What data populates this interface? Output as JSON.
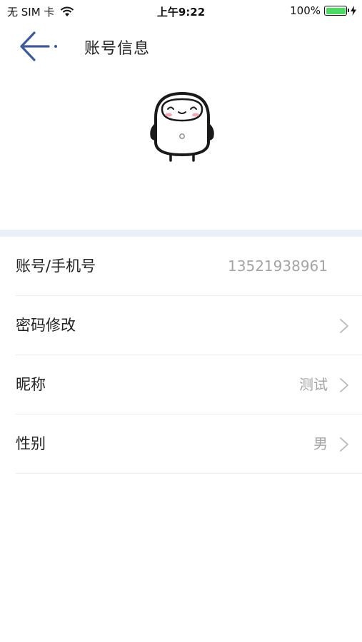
{
  "status_bar": {
    "carrier": "无 SIM 卡",
    "time": "上午9:22",
    "battery_percent": "100%",
    "battery_level": 1.0,
    "battery_color": "#4cd964"
  },
  "nav": {
    "back_icon": "back-arrow-icon",
    "title": "账号信息"
  },
  "avatar": {
    "icon": "robot-mascot-avatar"
  },
  "rows": [
    {
      "label": "账号/手机号",
      "value": "13521938961",
      "chevron": false
    },
    {
      "label": "密码修改",
      "value": "",
      "chevron": true
    },
    {
      "label": "昵称",
      "value": "测试",
      "chevron": true
    },
    {
      "label": "性别",
      "value": "男",
      "chevron": true
    }
  ],
  "colors": {
    "accent": "#3d5a96",
    "divider_band": "#eaf0f8",
    "value_text": "#a4a4a4"
  }
}
